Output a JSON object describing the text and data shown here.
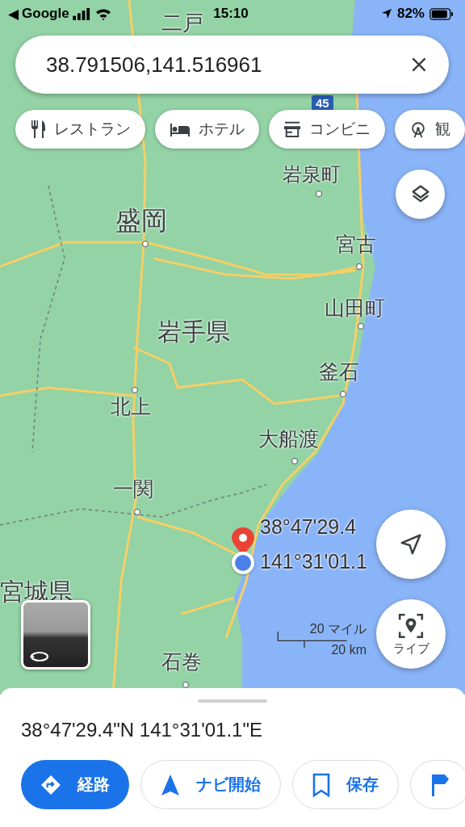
{
  "status_bar": {
    "back_arrow": "◀",
    "back_app": "Google",
    "time": "15:10",
    "battery": "82%"
  },
  "search": {
    "value": "38.791506,141.516961"
  },
  "chips": [
    {
      "kind": "restaurant",
      "label": "レストラン"
    },
    {
      "kind": "hotel",
      "label": "ホテル"
    },
    {
      "kind": "store",
      "label": "コンビニ"
    },
    {
      "kind": "attraction",
      "label": "観"
    }
  ],
  "map": {
    "places": [
      {
        "name": "二戸"
      },
      {
        "name": "岩泉町"
      },
      {
        "name": "盛岡"
      },
      {
        "name": "宮古"
      },
      {
        "name": "山田町"
      },
      {
        "name": "岩手県"
      },
      {
        "name": "釜石"
      },
      {
        "name": "北上"
      },
      {
        "name": "大船渡"
      },
      {
        "name": "一関"
      },
      {
        "name": "宮城県"
      },
      {
        "name": "石巻"
      }
    ],
    "route_shield": "45",
    "pin_labels": [
      "38°47'29.4",
      "141°31'01.1"
    ],
    "scale": {
      "miles": "20 マイル",
      "km": "20 km"
    },
    "live_button": "ライブ"
  },
  "sheet": {
    "title": "38°47'29.4\"N 141°31'01.1\"E",
    "actions": [
      {
        "kind": "directions",
        "label": "経路"
      },
      {
        "kind": "navigate",
        "label": "ナビ開始"
      },
      {
        "kind": "save",
        "label": "保存"
      },
      {
        "kind": "flag"
      }
    ]
  }
}
